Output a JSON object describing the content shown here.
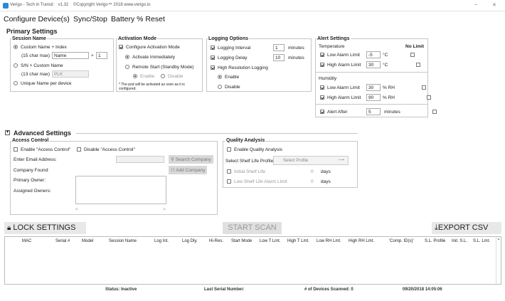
{
  "window": {
    "title": "Verigo - Tech in Transit",
    "version": "v1.32",
    "copyright": "©Copyright Verigo™ 2018 www.verigo.io",
    "min": "–",
    "close": "✕"
  },
  "menu": [
    "Configure Device(s)",
    "Sync/Stop",
    "Battery % Reset"
  ],
  "primary": {
    "title": "Primary Settings",
    "session": {
      "title": "Session Name",
      "custom_index": "Custom Name + Index",
      "max15": "(15 char max)",
      "name_value": "Name",
      "plus": "+",
      "index_value": "1",
      "sn_custom": "S/N + Custom Name",
      "max13": "(13 char max)",
      "sn_value": "PLK",
      "unique": "Unique Name per device"
    },
    "activation": {
      "title": "Activation Mode",
      "configure": "Configure Activation Mode",
      "immediately": "Activate Immediately",
      "remote": "Remote Start (Standby Mode)",
      "enable": "Enable",
      "disable": "Disable",
      "note1": "* The pod will be activated as soon as it is",
      "note2": "configured."
    },
    "logging": {
      "title": "Logging Options",
      "interval": "Logging Interval",
      "interval_value": "1",
      "delay": "Logging Delay",
      "delay_value": "10",
      "minutes": "minutes",
      "high_res": "High Resolution Logging",
      "enable": "Enable",
      "disable": "Disable"
    },
    "alert": {
      "title": "Alert Settings",
      "temperature": "Temperature",
      "no_limit": "No Limit",
      "low_alarm": "Low Alarm Limit",
      "low_temp": "-5",
      "high_alarm": "High Alarm Limit",
      "high_temp": "30",
      "unit_c": "°C",
      "humidity": "Humidity",
      "low_rh": "30",
      "high_rh": "90",
      "unit_rh": "% RH",
      "alert_after": "Alert After",
      "alert_after_value": "5",
      "minutes": "minutes"
    }
  },
  "advanced": {
    "title": "Advanced Settings",
    "access": {
      "title": "Access Control",
      "enable": "Enable \"Access Control\"",
      "disable": "Disable \"Access Control\"",
      "email": "Enter Email Address:",
      "search": "Search Company",
      "company": "Company Found:",
      "add": "Add Company",
      "primary_owner": "Primary Owner:",
      "assigned": "Assigned Owners:",
      "left": "<",
      "right": ">"
    },
    "quality": {
      "title": "Quality Analysis",
      "enable": "Enable Quality Analysis",
      "select": "Select Shelf Life Profile",
      "select_btn": "Select Profile",
      "initial": "Initial Shelf Life",
      "initial_value": "0",
      "low_alarm": "Low Shelf Life Alarm Limit",
      "low_value": "0",
      "days": "days"
    }
  },
  "actions": {
    "lock": "LOCK SETTINGS",
    "scan": "START SCAN",
    "export": "EXPORT CSV"
  },
  "table": {
    "columns": [
      "MAC",
      "Serial #",
      "Model",
      "Session Name",
      "Log Int.",
      "Log Dly.",
      "Hi-Res.",
      "Start Mode",
      "Low T Lmt.",
      "High T Lmt.",
      "Low RH Lmt.",
      "High RH Lmt.",
      "'Comp. ID(s)'",
      "S.L. Profile",
      "Init. S.L.",
      "S.L. Lmt."
    ]
  },
  "status": {
    "status": "Status: Inactive",
    "serial": "Last Serial Number:",
    "devices": "# of Devices Scanned: 0",
    "datetime": "09/20/2018 14:05:06"
  }
}
